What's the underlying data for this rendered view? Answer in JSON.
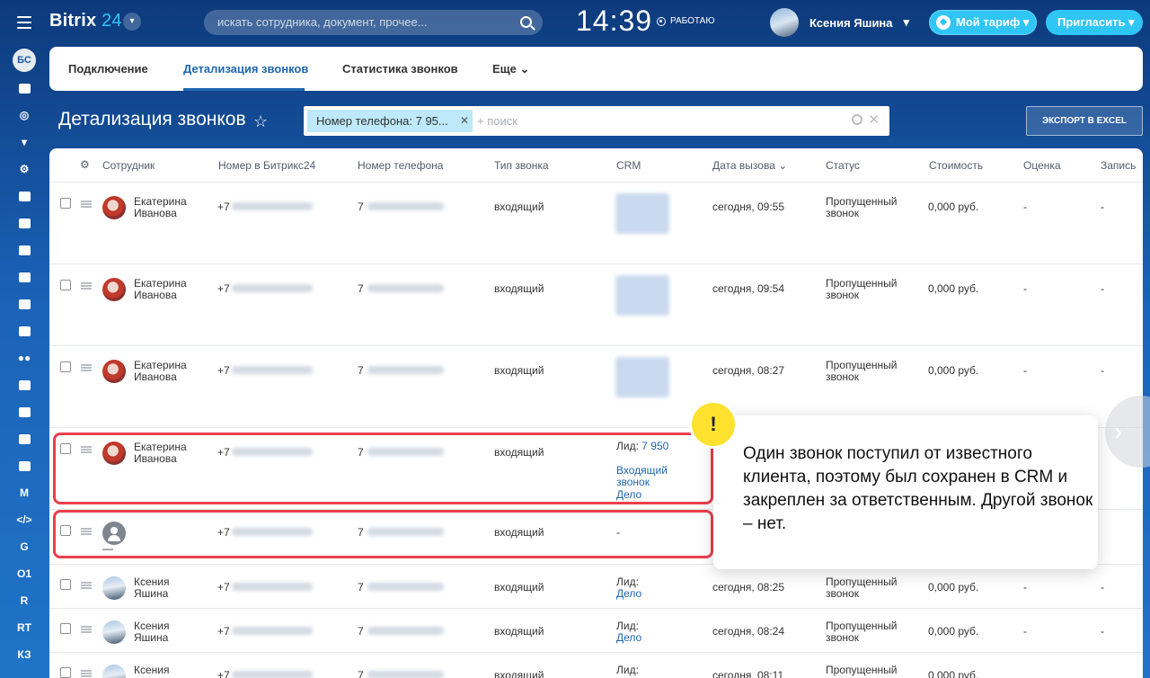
{
  "app": {
    "logo_main": "Bitrix",
    "logo_num": "24",
    "search_placeholder": "искать сотрудника, документ, прочее...",
    "clock": "14:39",
    "work_status": "РАБОТАЮ",
    "user_name": "Ксения Яшина",
    "tariff_label": "Мой тариф",
    "invite_label": "Пригласить"
  },
  "sidebar": {
    "user_initials": "БС",
    "items": [
      "G",
      "O1",
      "R",
      "RT",
      "КЗ"
    ]
  },
  "tabs": [
    {
      "label": "Подключение"
    },
    {
      "label": "Детализация звонков"
    },
    {
      "label": "Статистика звонков"
    },
    {
      "label": "Еще"
    }
  ],
  "page": {
    "title": "Детализация звонков",
    "filter_chip": "Номер телефона: 7 95...",
    "filter_placeholder": "+ поиск",
    "export_label": "ЭКСПОРТ В EXCEL"
  },
  "columns": [
    "Сотрудник",
    "Номер в Битрикс24",
    "Номер телефона",
    "Тип звонка",
    "CRM",
    "Дата вызова",
    "Статус",
    "Стоимость",
    "Оценка",
    "Запись"
  ],
  "rows": [
    {
      "first": "Екатерина",
      "last": "Иванова",
      "b24": "+7",
      "phone": "7",
      "type": "входящий",
      "crm_label": "",
      "crm_value": "",
      "crm_link1": "",
      "crm_link2": "",
      "date": "сегодня, 09:55",
      "status1": "Пропущенный",
      "status2": "звонок",
      "cost": "0,000 руб.",
      "rating": "-",
      "record": "-"
    },
    {
      "first": "Екатерина",
      "last": "Иванова",
      "b24": "+7",
      "phone": "7",
      "type": "входящий",
      "crm_label": "",
      "crm_value": "",
      "crm_link1": "",
      "crm_link2": "",
      "date": "сегодня, 09:54",
      "status1": "Пропущенный",
      "status2": "звонок",
      "cost": "0,000 руб.",
      "rating": "-",
      "record": "-"
    },
    {
      "first": "Екатерина",
      "last": "Иванова",
      "b24": "+7",
      "phone": "7",
      "type": "входящий",
      "crm_label": "",
      "crm_value": "",
      "crm_link1": "",
      "crm_link2": "",
      "date": "сегодня, 08:27",
      "status1": "Пропущенный",
      "status2": "звонок",
      "cost": "0,000 руб.",
      "rating": "-",
      "record": "-"
    },
    {
      "first": "Екатерина",
      "last": "Иванова",
      "b24": "+7",
      "phone": "7",
      "type": "входящий",
      "crm_label": "Лид:",
      "crm_value": "7 950",
      "crm_link1": "Входящий звонок",
      "crm_link2": "Дело",
      "date": "",
      "status1": "",
      "status2": "",
      "cost": "",
      "rating": "",
      "record": "-"
    },
    {
      "first": "—",
      "last": "",
      "b24": "+7",
      "phone": "7",
      "type": "входящий",
      "crm_label": "-",
      "crm_value": "",
      "crm_link1": "",
      "crm_link2": "",
      "date": "",
      "status1": "",
      "status2": "",
      "cost": "",
      "rating": "",
      "record": ""
    },
    {
      "first": "Ксения",
      "last": "Яшина",
      "b24": "+7",
      "phone": "7",
      "type": "входящий",
      "crm_label": "Лид:",
      "crm_value": "",
      "crm_link1": "",
      "crm_link2": "Дело",
      "date": "сегодня, 08:25",
      "status1": "Пропущенный",
      "status2": "звонок",
      "cost": "0,000 руб.",
      "rating": "-",
      "record": "-"
    },
    {
      "first": "Ксения",
      "last": "Яшина",
      "b24": "+7",
      "phone": "7",
      "type": "входящий",
      "crm_label": "Лид:",
      "crm_value": "",
      "crm_link1": "",
      "crm_link2": "Дело",
      "date": "сегодня, 08:24",
      "status1": "Пропущенный",
      "status2": "звонок",
      "cost": "0,000 руб.",
      "rating": "-",
      "record": "-"
    },
    {
      "first": "Ксения",
      "last": "",
      "b24": "+7",
      "phone": "7",
      "type": "входящий",
      "crm_label": "Лид:",
      "crm_value": "",
      "crm_link1": "",
      "crm_link2": "",
      "date": "сегодня, 08:11",
      "status1": "Пропущенный",
      "status2": "",
      "cost": "0,000 руб.",
      "rating": "",
      "record": ""
    }
  ],
  "callout": {
    "mark": "!",
    "text": "Один звонок поступил от известного клиента, поэтому был сохранен в CRM и закреплен за ответственным. Другой звонок – нет."
  }
}
